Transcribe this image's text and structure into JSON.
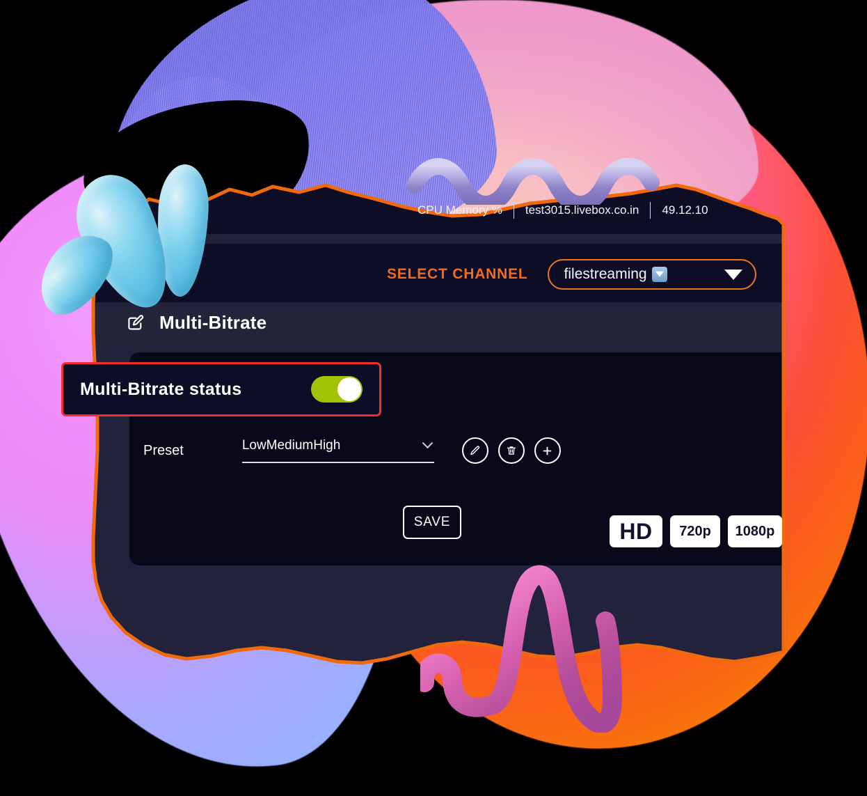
{
  "statusbar": {
    "metrics_text": "CPU        Memory        %",
    "host": "test3015.livebox.co.in",
    "ip": "49.12.10"
  },
  "channel": {
    "label": "SELECT CHANNEL",
    "selected": "filestreaming",
    "glyph_icon": "blue-select-arrow-icon",
    "caret_icon": "chevron-down-icon"
  },
  "section": {
    "title": "Multi-Bitrate",
    "title_icon": "edit-square-icon"
  },
  "status_strip": {
    "label": "Multi-Bitrate status",
    "toggle_state": "on",
    "highlight_color": "#f22d2d",
    "toggle_on_color": "#a2c406"
  },
  "preset": {
    "label": "Preset",
    "value": "LowMediumHigh",
    "caret_icon": "chevron-down-icon",
    "actions": [
      {
        "name": "edit-preset-button",
        "icon": "pencil-icon"
      },
      {
        "name": "delete-preset-button",
        "icon": "trash-icon"
      },
      {
        "name": "add-preset-button",
        "icon": "plus-icon"
      }
    ]
  },
  "actions": {
    "save_label": "SAVE"
  },
  "quality_badges": [
    {
      "label": "HD"
    },
    {
      "label": "720p"
    },
    {
      "label": "1080p"
    }
  ],
  "theme": {
    "accent_orange": "#f26b1d",
    "panel_dark": "#0e0d26",
    "page_dark": "#22223a",
    "card_dark": "#0a0919",
    "torn_edge": "#f0690c"
  }
}
